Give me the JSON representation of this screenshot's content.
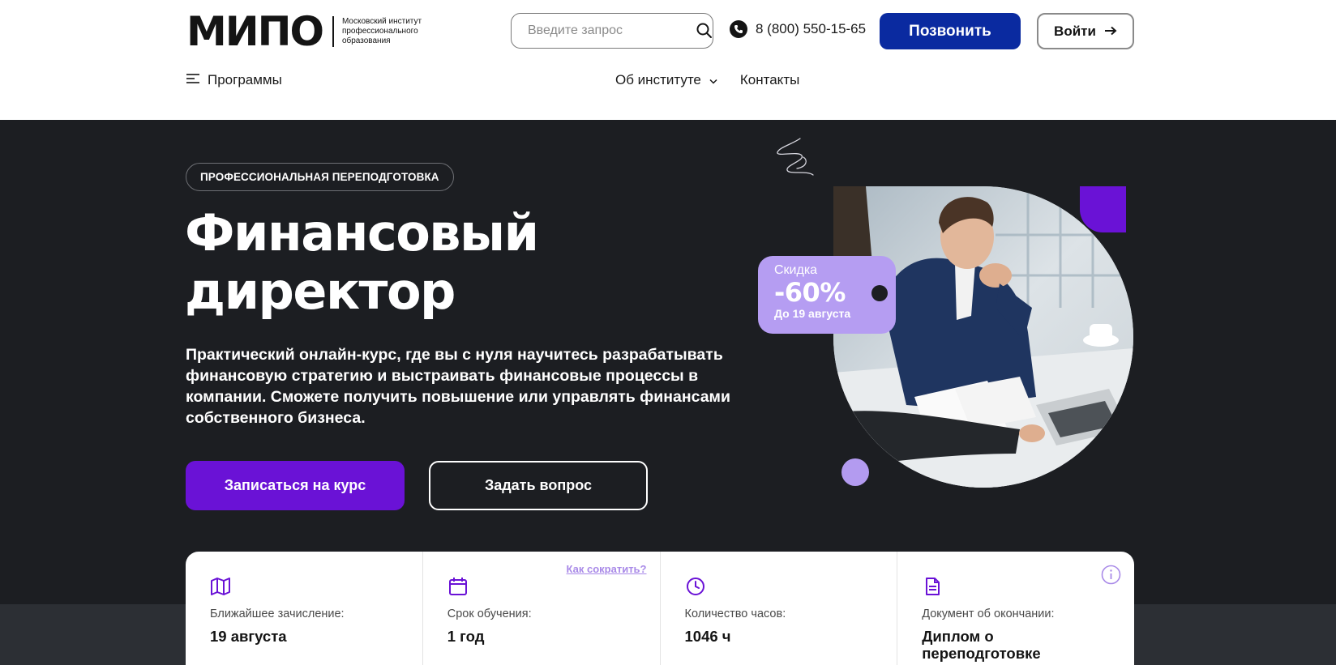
{
  "header": {
    "logo_main": "МИПО",
    "logo_sub": "Московский институт профессионального образования",
    "search_placeholder": "Введите запрос",
    "phone": "8 (800) 550-15-65",
    "call_button": "Позвонить",
    "login_button": "Войти"
  },
  "nav": {
    "programs": "Программы",
    "about": "Об институте",
    "contacts": "Контакты"
  },
  "hero": {
    "badge": "ПРОФЕССИОНАЛЬНАЯ ПЕРЕПОДГОТОВКА",
    "title_line1": "Финансовый",
    "title_line2": "директор",
    "description": "Практический онлайн-курс, где вы с нуля научитесь разрабатывать финансовую стратегию и выстраивать финансовые процессы в компании. Сможете получить повышение или управлять финансами собственного бизнеса.",
    "enroll_button": "Записаться на курс",
    "ask_button": "Задать вопрос"
  },
  "discount": {
    "label": "Скидка",
    "value": "-60%",
    "until": "До 19 августа"
  },
  "info": {
    "shorten_link": "Как сократить?",
    "items": [
      {
        "icon": "map-icon",
        "label": "Ближайшее зачисление:",
        "value": "19 августа"
      },
      {
        "icon": "calendar-icon",
        "label": "Срок обучения:",
        "value": "1 год"
      },
      {
        "icon": "clock-icon",
        "label": "Количество часов:",
        "value": "1046 ч"
      },
      {
        "icon": "document-icon",
        "label": "Документ об окончании:",
        "value": "Диплом о переподготовке"
      }
    ]
  },
  "colors": {
    "brand_blue": "#0a2aa0",
    "brand_purple": "#6a12d6",
    "lilac": "#b59df2",
    "hero_bg": "#1c1e22"
  }
}
